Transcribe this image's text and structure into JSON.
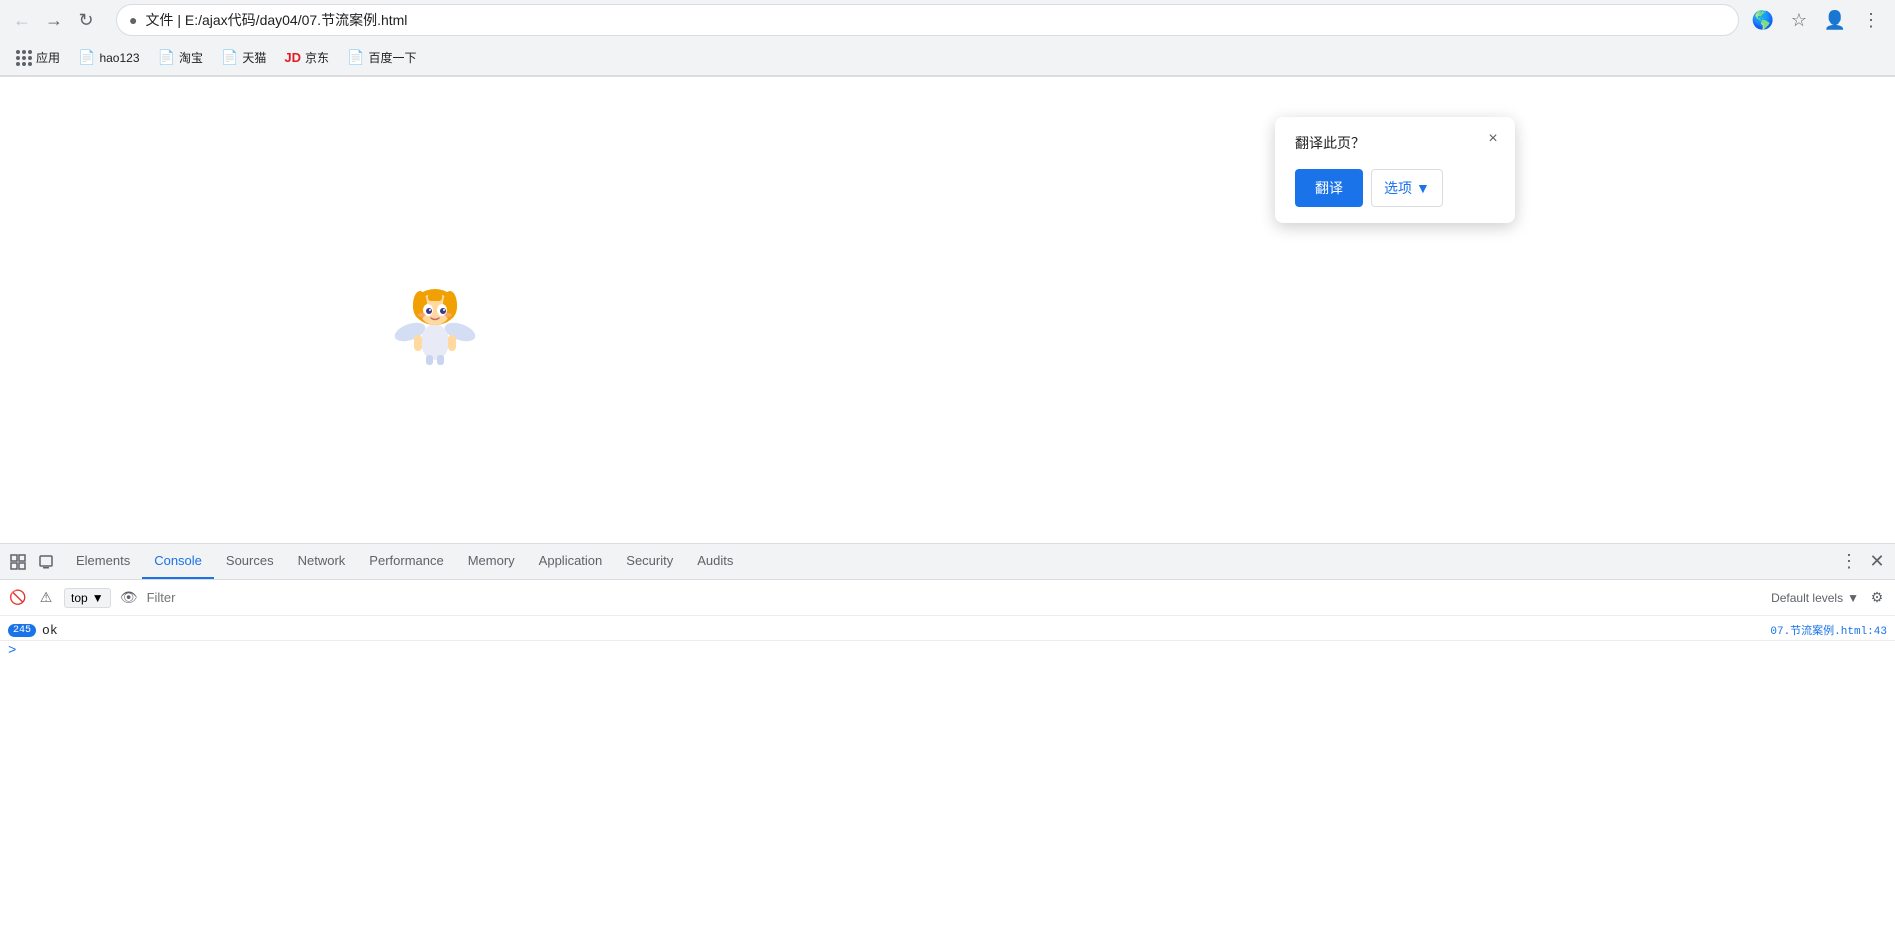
{
  "browser": {
    "title": "文件 | E:/ajax代码/day04/07.节流案例.html",
    "url": "文件 | E:/ajax代码/day04/07.节流案例.html",
    "url_short": "E:/ajax代码/day04/07.节流案例.html",
    "back_label": "←",
    "forward_label": "→",
    "reload_label": "↻",
    "translate_icon": "🌐",
    "star_icon": "☆",
    "profile_icon": "👤",
    "menu_icon": "⋮"
  },
  "bookmarks": {
    "apps_label": "应用",
    "items": [
      {
        "label": "hao123",
        "icon": "📄"
      },
      {
        "label": "淘宝",
        "icon": "📄"
      },
      {
        "label": "天猫",
        "icon": "📄"
      },
      {
        "label": "京东",
        "icon": "📄"
      },
      {
        "label": "百度一下",
        "icon": "📄"
      }
    ]
  },
  "translate_popup": {
    "title": "翻译此页？",
    "translate_btn": "翻译",
    "options_btn": "选项",
    "close_label": "×"
  },
  "devtools": {
    "tabs": [
      {
        "id": "elements",
        "label": "Elements",
        "active": false
      },
      {
        "id": "console",
        "label": "Console",
        "active": true
      },
      {
        "id": "sources",
        "label": "Sources",
        "active": false
      },
      {
        "id": "network",
        "label": "Network",
        "active": false
      },
      {
        "id": "performance",
        "label": "Performance",
        "active": false
      },
      {
        "id": "memory",
        "label": "Memory",
        "active": false
      },
      {
        "id": "application",
        "label": "Application",
        "active": false
      },
      {
        "id": "security",
        "label": "Security",
        "active": false
      },
      {
        "id": "audits",
        "label": "Audits",
        "active": false
      }
    ],
    "console": {
      "context": "top",
      "filter_placeholder": "Filter",
      "levels_label": "Default levels",
      "log_entry": {
        "badge": "245",
        "text": "ok",
        "source": "07.节流案例.html:43"
      },
      "prompt_symbol": ">"
    }
  }
}
